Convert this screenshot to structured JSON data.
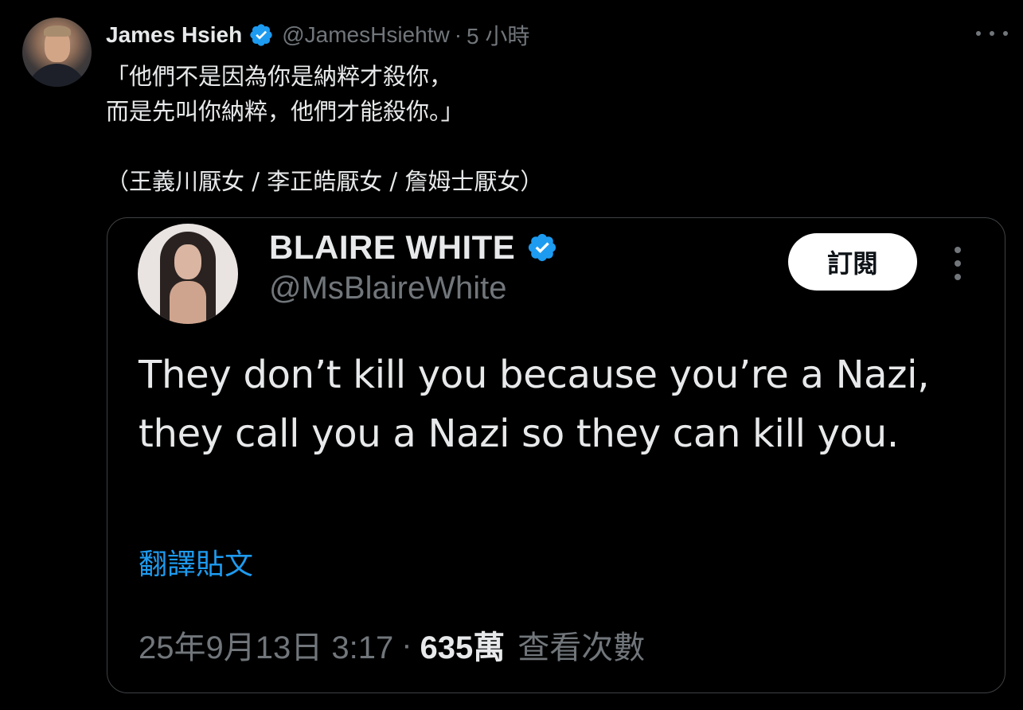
{
  "post": {
    "author_name": "James Hsieh",
    "handle": "@JamesHsiehtw",
    "separator": "·",
    "time": "5 小時",
    "text": "「他們不是因為你是納粹才殺你，\n而是先叫你納粹，他們才能殺你。」\n\n（王義川厭女 / 李正皓厭女 / 詹姆士厭女）",
    "more_icon": "more-horizontal-icon"
  },
  "quote": {
    "author_name": "BLAIRE WHITE",
    "handle": "@MsBlaireWhite",
    "subscribe_label": "訂閱",
    "text": "They don’t kill you because you’re a Nazi, they call you a Nazi so they can kill you.",
    "translate_label": "翻譯貼文",
    "date": "25年9月13日 3:17",
    "separator": "·",
    "views_count": "635萬",
    "views_label": "查看次數",
    "more_icon": "more-vertical-icon"
  },
  "colors": {
    "background": "#000000",
    "text_primary": "#e7e9ea",
    "text_secondary": "#71767b",
    "accent_blue": "#1d9bf0",
    "verified_badge": "#1d9bf0",
    "card_border": "#3e4144"
  }
}
